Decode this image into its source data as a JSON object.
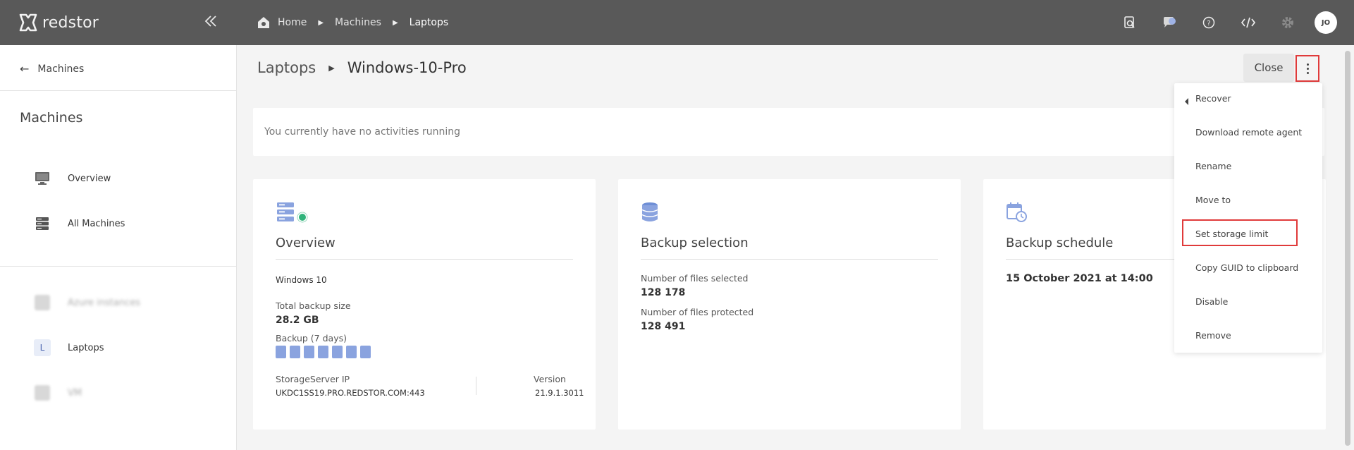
{
  "topbar": {
    "logo_text": "redstor",
    "breadcrumbs": [
      "Home",
      "Machines",
      "Laptops"
    ],
    "avatar_initials": "JO",
    "icons": [
      "search-icon",
      "notifications-icon",
      "help-icon",
      "code-icon",
      "settings-icon"
    ]
  },
  "sidebar": {
    "back_label": "Machines",
    "title": "Machines",
    "nav": [
      {
        "label": "Overview",
        "icon": "monitor-icon"
      },
      {
        "label": "All Machines",
        "icon": "server-stack-icon"
      }
    ],
    "groups": [
      {
        "label": "Azure instances",
        "icon": "blurred-icon"
      },
      {
        "label": "Laptops",
        "icon_letter": "L"
      },
      {
        "label": "VM",
        "icon": "blurred-icon"
      }
    ]
  },
  "header": {
    "parent": "Laptops",
    "title": "Windows-10-Pro",
    "close_label": "Close"
  },
  "activity_text": "You currently have no activities running",
  "cards": {
    "overview": {
      "title": "Overview",
      "os": "Windows 10",
      "total_backup_label": "Total backup size",
      "total_backup_value": "28.2 GB",
      "backup_days_label": "Backup (7 days)",
      "backup_days_count": 7,
      "storage_ip_label": "StorageServer IP",
      "storage_ip_value": "UKDC1SS19.PRO.REDSTOR.COM:443",
      "version_label": "Version",
      "version_value": "21.9.1.3011"
    },
    "selection": {
      "title": "Backup selection",
      "files_selected_label": "Number of files selected",
      "files_selected_value": "128 178",
      "files_protected_label": "Number of files protected",
      "files_protected_value": "128 491"
    },
    "schedule": {
      "title": "Backup schedule",
      "next_run": "15 October 2021 at 14:00"
    }
  },
  "menu": {
    "items": [
      "Recover",
      "Download remote agent",
      "Rename",
      "Move to",
      "Set storage limit",
      "Copy GUID to clipboard",
      "Disable",
      "Remove"
    ]
  },
  "colors": {
    "topbar": "#595959",
    "accent_blue": "#8aa3df",
    "highlight_red": "#e03a3a",
    "status_green": "#2fb37a"
  }
}
